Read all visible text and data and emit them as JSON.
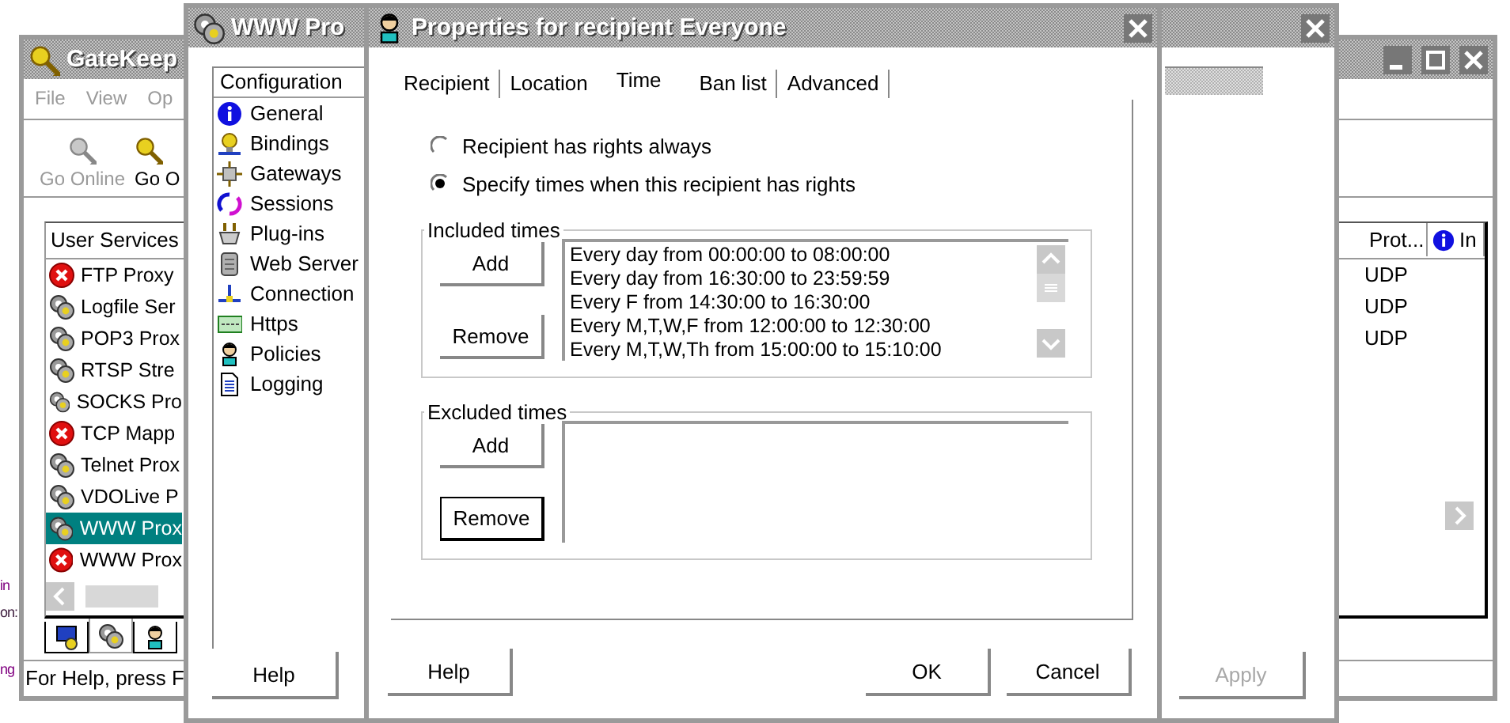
{
  "desktop_fragments": [
    "in",
    "on:",
    "ng"
  ],
  "gatekeeper": {
    "title": "GateKeep",
    "menu": [
      {
        "label": "File",
        "disabled": true
      },
      {
        "label": "View",
        "disabled": true
      },
      {
        "label": "Op",
        "disabled": true
      }
    ],
    "toolbar": [
      {
        "label": "Go Online",
        "disabled": true
      },
      {
        "label": "Go O",
        "disabled": false
      }
    ],
    "columns": [
      "User Services",
      "Prot...",
      "In"
    ],
    "rows": [
      {
        "name": "FTP Proxy",
        "stopped": true,
        "protocol": "UDP",
        "selected": false
      },
      {
        "name": "Logfile Ser",
        "stopped": false,
        "protocol": "UDP",
        "selected": false
      },
      {
        "name": "POP3 Prox",
        "stopped": false,
        "protocol": "UDP",
        "selected": false
      },
      {
        "name": "RTSP Stre",
        "stopped": false,
        "selected": false
      },
      {
        "name": "SOCKS Pro",
        "stopped": false,
        "selected": false
      },
      {
        "name": "TCP Mapp",
        "stopped": true,
        "selected": false
      },
      {
        "name": "Telnet Prox",
        "stopped": false,
        "selected": false
      },
      {
        "name": "VDOLive P",
        "stopped": false,
        "selected": false
      },
      {
        "name": "WWW Prox",
        "stopped": false,
        "selected": true
      },
      {
        "name": "WWW Prox",
        "stopped": true,
        "selected": false
      }
    ],
    "view_tabs": [
      {
        "selected": false
      },
      {
        "selected": true
      },
      {
        "selected": false
      }
    ],
    "status_bar": "For Help, press F"
  },
  "proxy_window": {
    "title": "WWW Pro",
    "config_header": "Configuration",
    "config_items": [
      "General",
      "Bindings",
      "Gateways",
      "Sessions",
      "Plug-ins",
      "Web Server",
      "Connection",
      "Https",
      "Policies",
      "Logging"
    ],
    "buttons": [
      {
        "label": "Help",
        "disabled": false
      },
      {
        "label": "Apply",
        "disabled": true
      }
    ]
  },
  "dialog": {
    "title": "Properties for recipient Everyone",
    "tabs": [
      {
        "label": "Recipient",
        "selected": false
      },
      {
        "label": "Location",
        "selected": false
      },
      {
        "label": "Time",
        "selected": true
      },
      {
        "label": "Ban list",
        "selected": false
      },
      {
        "label": "Advanced",
        "selected": false
      }
    ],
    "options": [
      {
        "label": "Recipient has rights always",
        "selected": false
      },
      {
        "label": "Specify times when this recipient has rights",
        "selected": true
      }
    ],
    "groups": [
      {
        "legend": "Included times",
        "buttons": [
          {
            "label": "Add",
            "focused": false
          },
          {
            "label": "Remove",
            "focused": false
          }
        ],
        "entries": [
          "Every day from 00:00:00 to 08:00:00",
          "Every day from 16:30:00 to 23:59:59",
          "Every F from 14:30:00 to 16:30:00",
          "Every M,T,W,F from 12:00:00 to 12:30:00",
          "Every M,T,W,Th from 15:00:00 to 15:10:00"
        ]
      },
      {
        "legend": "Excluded times",
        "buttons": [
          {
            "label": "Add",
            "focused": false
          },
          {
            "label": "Remove",
            "focused": true
          }
        ]
      }
    ],
    "buttons": [
      {
        "label": "Help"
      },
      {
        "label": "OK"
      },
      {
        "label": "Cancel"
      }
    ]
  }
}
